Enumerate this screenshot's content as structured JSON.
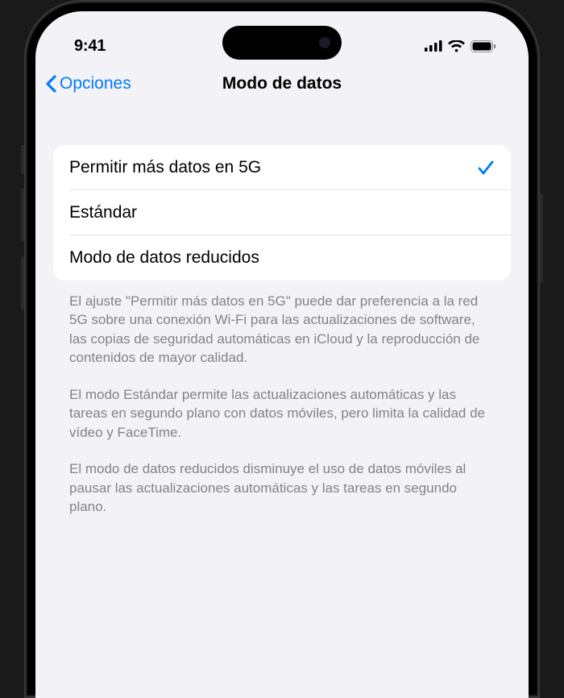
{
  "status": {
    "time": "9:41"
  },
  "nav": {
    "back_label": "Opciones",
    "title": "Modo de datos"
  },
  "options": {
    "items": [
      {
        "label": "Permitir más datos en 5G",
        "selected": true
      },
      {
        "label": "Estándar",
        "selected": false
      },
      {
        "label": "Modo de datos reducidos",
        "selected": false
      }
    ]
  },
  "footer": {
    "paragraphs": [
      "El ajuste \"Permitir más datos en 5G\" puede dar preferencia a la red 5G sobre una conexión Wi-Fi para las actualizaciones de software, las copias de seguridad automáticas en iCloud y la reproducción de contenidos de mayor calidad.",
      "El modo Estándar permite las actualizaciones automáticas y las tareas en segundo plano con datos móviles, pero limita la calidad de vídeo y FaceTime.",
      "El modo de datos reducidos disminuye el uso de datos móviles al pausar las actualizaciones automáticas y las tareas en segundo plano."
    ]
  }
}
